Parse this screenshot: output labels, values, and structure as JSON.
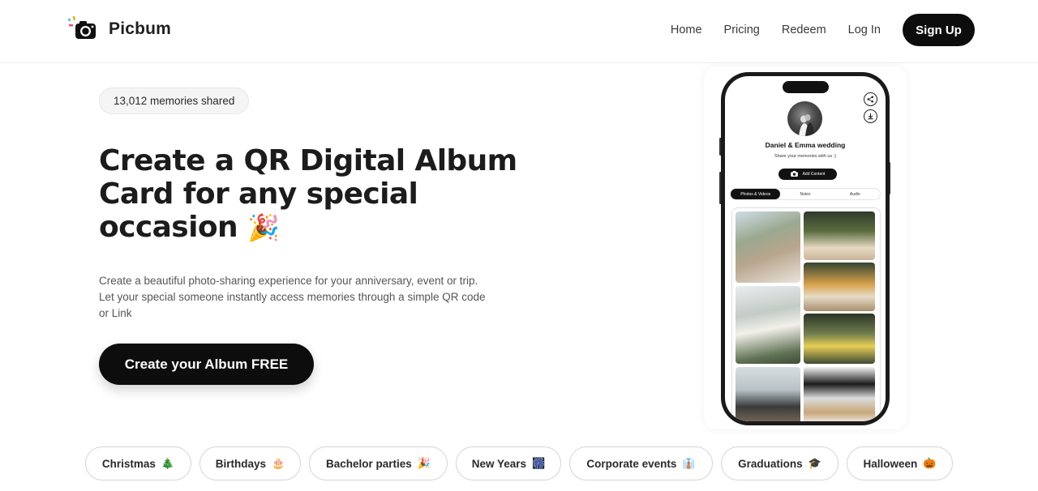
{
  "header": {
    "brand": "Picbum",
    "logo_icon": "camera-icon",
    "nav": [
      "Home",
      "Pricing",
      "Redeem",
      "Log In"
    ],
    "signup_label": "Sign Up"
  },
  "hero": {
    "badge": "13,012 memories shared",
    "title_lines": [
      "Create a QR Digital Album",
      "Card for any special",
      "occasion"
    ],
    "title_emoji": "🎉",
    "description": "Create a beautiful photo-sharing experience for your anniversary, event or trip. Let your special someone instantly access memories through a simple QR code or Link",
    "cta_label": "Create your Album FREE"
  },
  "phone": {
    "album_title": "Daniel & Emma wedding",
    "album_subtitle": "Share your memories with us :)",
    "add_content_label": "Add Content",
    "tabs": [
      "Photos & Videos",
      "Notes",
      "Audio"
    ],
    "active_tab": 0,
    "icons": [
      "share-icon",
      "download-icon",
      "camera-icon"
    ]
  },
  "occasions": [
    {
      "label": "Christmas",
      "emoji": "🎄"
    },
    {
      "label": "Birthdays",
      "emoji": "🎂"
    },
    {
      "label": "Bachelor parties",
      "emoji": "🎉"
    },
    {
      "label": "New Years",
      "emoji": "🎆"
    },
    {
      "label": "Corporate events",
      "emoji": "👔"
    },
    {
      "label": "Graduations",
      "emoji": "🎓"
    },
    {
      "label": "Halloween",
      "emoji": "🎃"
    }
  ],
  "colors": {
    "primary": "#0d0d0d",
    "text": "#1f1f1f",
    "muted": "#555555",
    "border": "#d5d5d5"
  }
}
